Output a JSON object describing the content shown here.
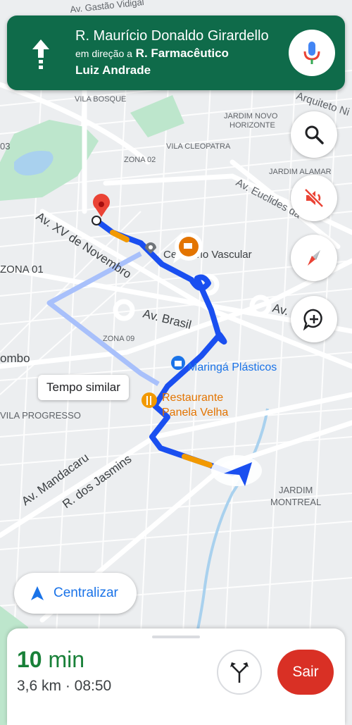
{
  "banner": {
    "street": "R. Maurício Donaldo Girardello",
    "toward_prefix": "em direção a",
    "toward_street_1": "R. Farmacêutico",
    "toward_street_2": "Luiz Andrade",
    "direction_icon": "arrow-up-icon",
    "mic_icon": "microphone-icon"
  },
  "map": {
    "labels": {
      "vila_bosque": "VILA BOSQUE",
      "jardim_novo": "JARDIM NOVO",
      "horizonte": "HORIZONTE",
      "vila_cleopatra": "VILA CLEOPATRA",
      "zona02": "ZONA 02",
      "jardim_alamar": "JARDIM ALAMAR",
      "euclides": "Av. Euclides da",
      "xv_novembro": "Av. XV de Novembro",
      "zona01": "ZONA 01",
      "cemiterio": "Cemitério Vascular",
      "brasil": "Av. Brasil",
      "av_right": "Av.",
      "zona09": "ZONA 09",
      "ombo": "ombo",
      "maringa": "Maringá Plásticos",
      "restaurante_1": "Restaurante",
      "restaurante_2": "Panela Velha",
      "vila_progresso": "VILA PROGRESSO",
      "mandacaru": "Av. Mandacaru",
      "jasmins": "R. dos Jasmins",
      "jardim_montreal_1": "JARDIM",
      "jardim_montreal_2": "MONTREAL",
      "gastao": "Av. Gastão Vidigal",
      "arquiteto": "Arquiteto Ni",
      "n03": "03"
    },
    "alt_route_tooltip": "Tempo similar"
  },
  "controls": {
    "search_icon": "search-icon",
    "mute_icon": "sound-off-icon",
    "compass_icon": "compass-icon",
    "report_icon": "add-report-icon",
    "recenter_label": "Centralizar"
  },
  "eta": {
    "minutes": "10",
    "unit": "min",
    "details": "3,6 km · 08:50",
    "exit_label": "Sair",
    "alt_icon": "alternate-routes-icon"
  },
  "colors": {
    "banner": "#0f6b4a",
    "route": "#1a4ff0",
    "traffic": "#f29900",
    "exit": "#d93025",
    "recenter": "#1a73e8",
    "eta_time": "#188038"
  }
}
